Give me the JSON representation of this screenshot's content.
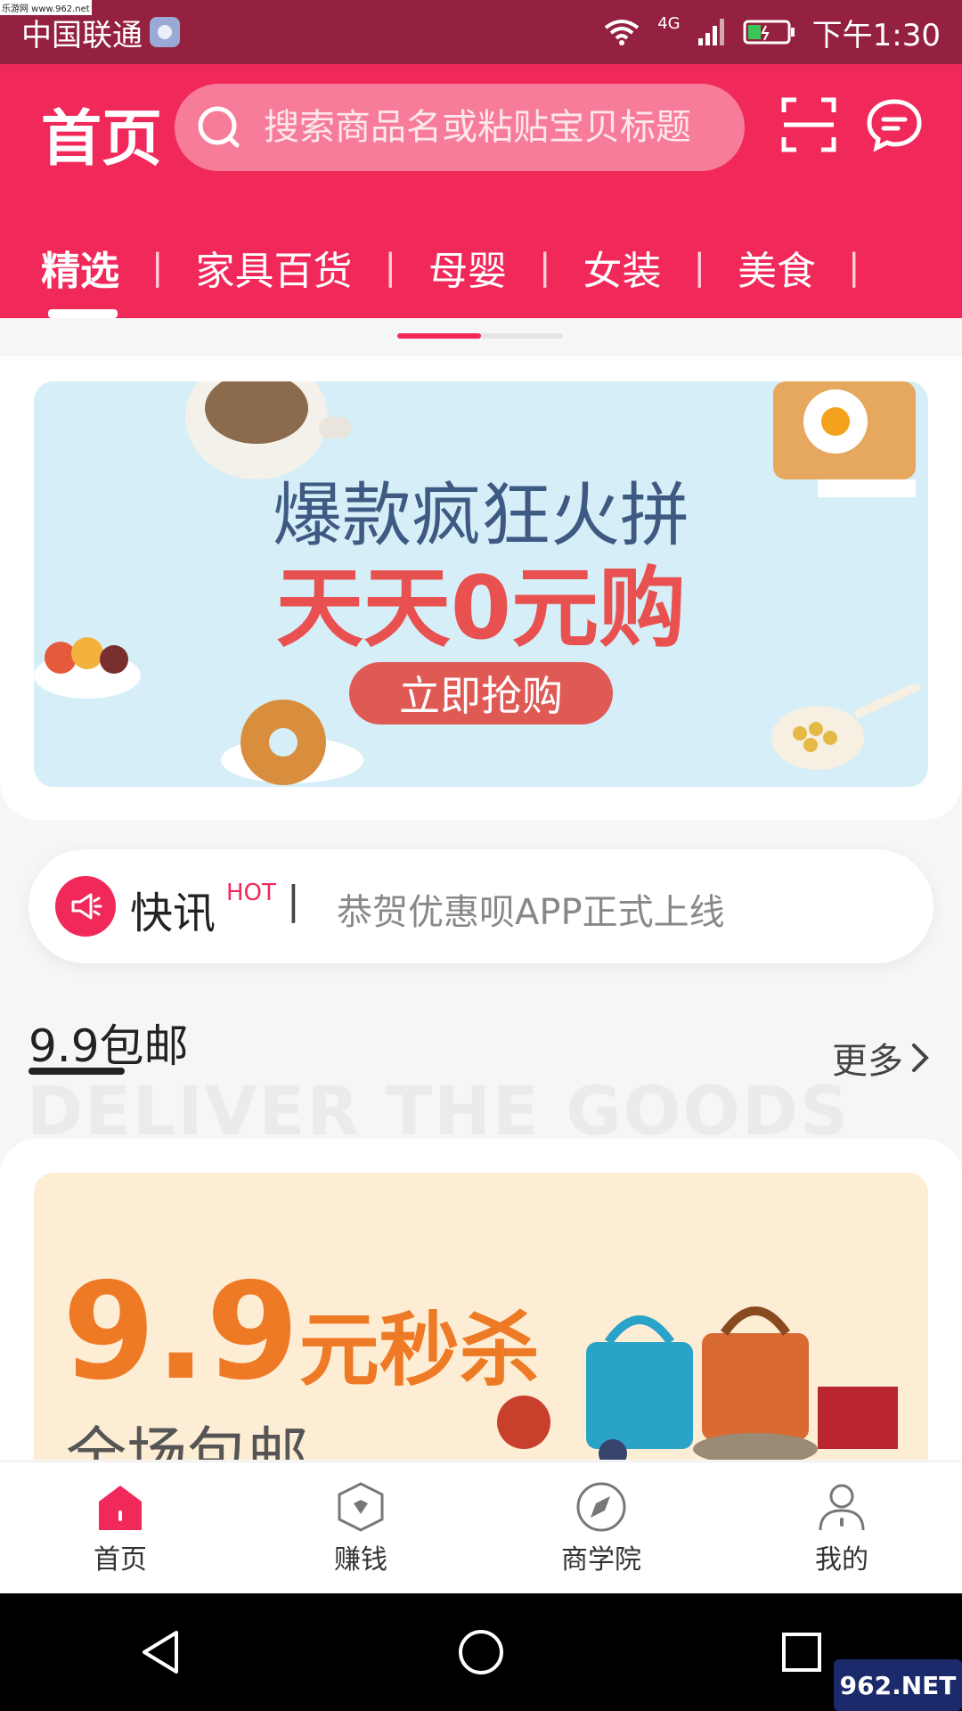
{
  "status_bar": {
    "watermark": "乐游网 www.962.net",
    "carrier": "中国联通",
    "network": "4G",
    "time": "下午1:30"
  },
  "header": {
    "title": "首页",
    "search": {
      "placeholder": "搜索商品名或粘贴宝贝标题"
    },
    "icons": [
      "scan-icon",
      "message-icon"
    ]
  },
  "tabs": [
    "精选",
    "家具百货",
    "母婴",
    "女装",
    "美食"
  ],
  "banner": {
    "line1": "爆款疯狂火拼",
    "line2": "天天0元购",
    "button": "立即抢购"
  },
  "news": {
    "title": "快讯",
    "badge": "HOT",
    "separator": "|",
    "text": "恭贺优惠呗APP正式上线"
  },
  "section": {
    "title": "9.9包邮",
    "more": "更多",
    "watermark": "DELIVER THE GOODS"
  },
  "promo": {
    "big": "9.9",
    "big_suffix": "元秒杀",
    "sub": "全场包邮"
  },
  "bottom_nav": [
    {
      "label": "首页",
      "icon": "home-icon",
      "active": true
    },
    {
      "label": "赚钱",
      "icon": "diamond-icon",
      "active": false
    },
    {
      "label": "商学院",
      "icon": "compass-icon",
      "active": false
    },
    {
      "label": "我的",
      "icon": "user-icon",
      "active": false
    }
  ],
  "brand_badge": "962.NET",
  "colors": {
    "primary": "#f0295a",
    "status_bar": "#94213f",
    "orange": "#ee7a26"
  }
}
